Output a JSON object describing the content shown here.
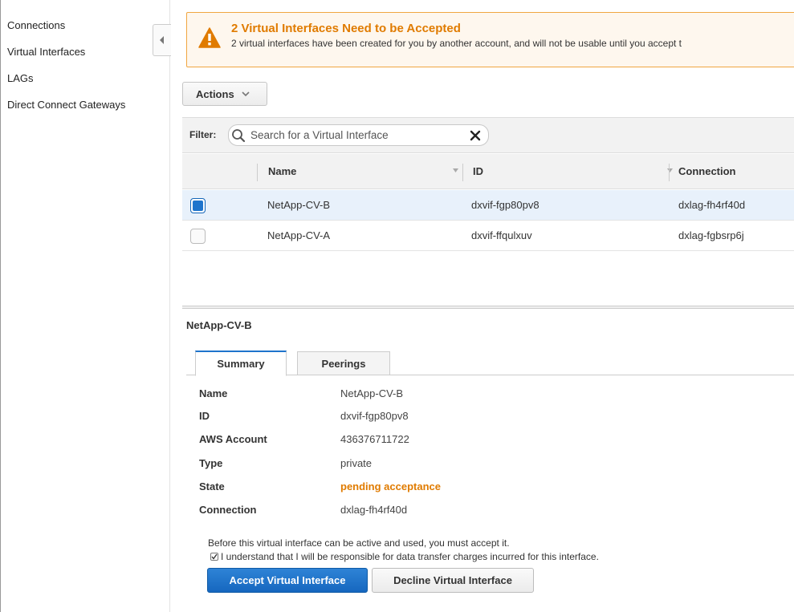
{
  "sidebar": {
    "items": [
      {
        "label": "Connections"
      },
      {
        "label": "Virtual Interfaces"
      },
      {
        "label": "LAGs"
      },
      {
        "label": "Direct Connect Gateways"
      }
    ]
  },
  "alert": {
    "title": "2 Virtual Interfaces Need to be Accepted",
    "text": "2 virtual interfaces have been created for you by another account, and will not be usable until you accept t",
    "icon": "warning-icon",
    "color": "#e07b00"
  },
  "toolbar": {
    "actions_label": "Actions"
  },
  "filter": {
    "label": "Filter:",
    "placeholder": "Search for a Virtual Interface"
  },
  "table": {
    "columns": [
      "Name",
      "ID",
      "Connection"
    ],
    "rows": [
      {
        "selected": true,
        "name": "NetApp-CV-B",
        "id": "dxvif-fgp80pv8",
        "connection": "dxlag-fh4rf40d"
      },
      {
        "selected": false,
        "name": "NetApp-CV-A",
        "id": "dxvif-ffqulxuv",
        "connection": "dxlag-fgbsrp6j"
      }
    ]
  },
  "detail": {
    "title": "NetApp-CV-B",
    "tabs": [
      {
        "label": "Summary"
      },
      {
        "label": "Peerings"
      }
    ],
    "fields": [
      {
        "label": "Name",
        "value": "NetApp-CV-B"
      },
      {
        "label": "ID",
        "value": "dxvif-fgp80pv8"
      },
      {
        "label": "AWS Account",
        "value": "436376711722"
      },
      {
        "label": "Type",
        "value": "private"
      },
      {
        "label": "State",
        "value": "pending acceptance"
      },
      {
        "label": "Connection",
        "value": "dxlag-fh4rf40d"
      }
    ],
    "notice": "Before this virtual interface can be active and used, you must accept it.",
    "confirm": "I understand that I will be responsible for data transfer charges incurred for this interface.",
    "accept_label": "Accept Virtual Interface",
    "decline_label": "Decline Virtual Interface"
  },
  "colors": {
    "accent": "#1e74cc",
    "warning": "#e07b00"
  }
}
